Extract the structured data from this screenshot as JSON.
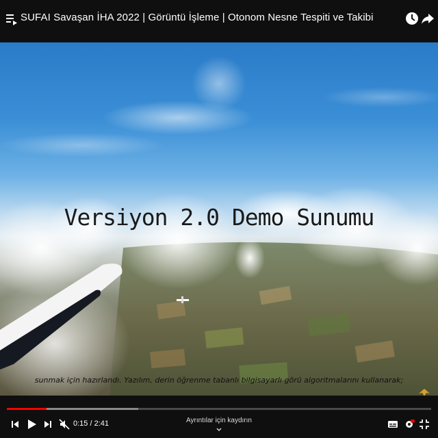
{
  "header": {
    "title": "SUFAI Savaşan İHA 2022 | Görüntü İşleme | Otonom Nesne Tespiti ve Takibi",
    "icons": [
      "playlist-icon",
      "watch-later-icon",
      "share-icon"
    ]
  },
  "video": {
    "overlay_title": "Versiyon 2.0 Demo Sunumu",
    "subtitle": "sunmak için hazırlandı. Yazılım, derin öğrenme tabanlı bilgisayarlı görü algoritmalarını kullanarak;"
  },
  "player": {
    "current_time": "0:15",
    "duration": "2:41",
    "time_display": "0:15 / 2:41",
    "played_fraction": 0.093,
    "buffered_fraction": 0.31,
    "details_hint": "Ayrıntılar için kaydırın",
    "icons": [
      "skip-previous-icon",
      "play-icon",
      "skip-next-icon",
      "mute-icon",
      "subtitles-icon",
      "settings-icon",
      "exit-fullscreen-icon"
    ],
    "colors": {
      "progress_played": "#ff0000",
      "progress_buffered": "#8a8a8a",
      "progress_track": "#4a4a4a"
    }
  }
}
